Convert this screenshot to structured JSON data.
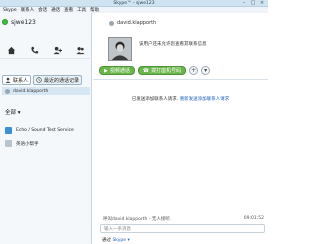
{
  "window": {
    "title": "Skype™ - sjwe123",
    "controls": [
      "–",
      "□",
      "×"
    ]
  },
  "menu": [
    "Skype",
    "联系人",
    "会话",
    "通话",
    "查看",
    "工具",
    "帮助"
  ],
  "user": {
    "name": "sjwe123",
    "status_color": "#3fbf3f"
  },
  "tabs": [
    {
      "label": "联系人",
      "active": true
    },
    {
      "label": "最近的通话记录",
      "active": false
    }
  ],
  "selected_contact": {
    "label": "david.klapporth"
  },
  "group": {
    "title": "全部 ▾"
  },
  "contacts": [
    {
      "name": "Echo / Sound Test Service",
      "color": "#3a8fd6"
    },
    {
      "name": "英语小帮手",
      "color": "#b9c3cc"
    }
  ],
  "profile": {
    "name": "david.klapporth",
    "mood": "该用户还未允许您查看其联系信息"
  },
  "actions": {
    "video_call": "视频通话",
    "call_phone": "拨打座机号码",
    "add": "+"
  },
  "info": {
    "text": "已发送添加联系人请求.",
    "link": "重新发送添加联系人请求"
  },
  "event": {
    "text": "呼叫david.klapporth - 无人接听.",
    "time": "09:01:52"
  },
  "input": {
    "placeholder": "输入一条消息"
  },
  "footer": {
    "via_label": "通过",
    "via_value": "Skype ▾"
  }
}
